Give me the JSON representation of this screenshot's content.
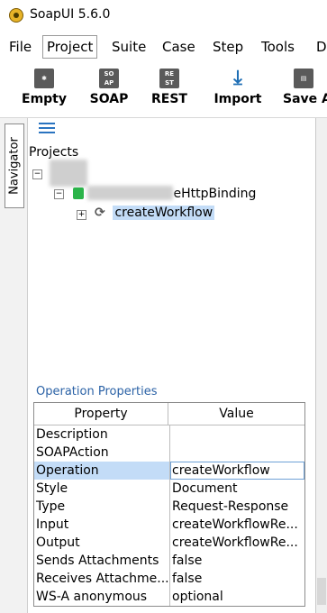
{
  "app": {
    "title": "SoapUI 5.6.0"
  },
  "menu": [
    "File",
    "Project",
    "Suite",
    "Case",
    "Step",
    "Tools",
    "D"
  ],
  "toolbar": [
    {
      "label": "Empty",
      "icon": "empty-project-icon"
    },
    {
      "label": "SOAP",
      "icon": "soap-icon",
      "badge": "SO AP"
    },
    {
      "label": "REST",
      "icon": "rest-icon",
      "badge": "RE ST"
    },
    {
      "label": "Import",
      "icon": "import-icon"
    },
    {
      "label": "Save A",
      "icon": "save-all-icon"
    }
  ],
  "navigator": {
    "label": "Navigator"
  },
  "tree": {
    "root_label": "Projects",
    "binding_label": "eHttpBinding",
    "operation_label": "createWorkflow"
  },
  "properties": {
    "title": "Operation Properties",
    "headers": {
      "property": "Property",
      "value": "Value"
    },
    "rows": [
      {
        "name": "Description",
        "value": ""
      },
      {
        "name": "SOAPAction",
        "value": ""
      },
      {
        "name": "Operation",
        "value": "createWorkflow",
        "selected": true
      },
      {
        "name": "Style",
        "value": "Document"
      },
      {
        "name": "Type",
        "value": "Request-Response"
      },
      {
        "name": "Input",
        "value": "createWorkflowRe..."
      },
      {
        "name": "Output",
        "value": "createWorkflowRe..."
      },
      {
        "name": "Sends Attachments",
        "value": "false"
      },
      {
        "name": "Receives Attachme...",
        "value": "false"
      },
      {
        "name": "WS-A anonymous",
        "value": "optional"
      }
    ]
  }
}
